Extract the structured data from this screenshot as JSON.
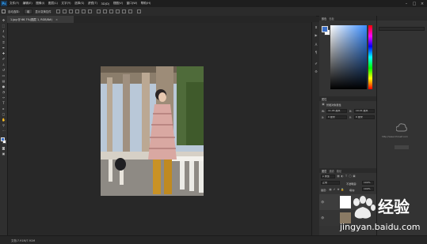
{
  "app": {
    "logo": "Ps"
  },
  "menubar": {
    "items": [
      "文件(F)",
      "编辑(E)",
      "图像(I)",
      "图层(L)",
      "文字(Y)",
      "选择(S)",
      "滤镜(T)",
      "3D(D)",
      "视图(V)",
      "窗口(W)",
      "帮助(H)"
    ],
    "window_controls": [
      "minimize-icon",
      "maximize-icon",
      "close-icon"
    ]
  },
  "optionsbar": {
    "labels": [
      "自动选择：",
      "组",
      "显示变换控件"
    ]
  },
  "document": {
    "tab_label": "1.jpg @ 66.7%(图层 1, RGB/8#)",
    "close_glyph": "×"
  },
  "statusbar": {
    "text": "文档:7.91M/7.91M"
  },
  "color_panel": {
    "title": "颜色",
    "tab2": "色板",
    "colors": {
      "foreground": "#3a6fc8",
      "background": "#ffffff",
      "field_top_right": "#3a8dff"
    }
  },
  "properties_panel": {
    "title": "属性",
    "subtitle": "智能对象属性",
    "w_label": "W:",
    "w_value": "11.45 厘米",
    "h_label": "H:",
    "h_value": "19.01 厘米",
    "x_label": "X:",
    "x_value": "0 厘米",
    "y_label": "Y:",
    "y_value": "0 厘米"
  },
  "layers_panel": {
    "title": "图层",
    "tab2": "通道",
    "tab3": "路径",
    "kind_label": "ρ 类型",
    "blend_mode": "正常",
    "opacity_label": "不透明度:",
    "opacity_value": "100%",
    "lock_label": "锁定:",
    "fill_label": "填充:",
    "fill_value": "100%",
    "layer_name": "图层 1"
  },
  "watermark": {
    "site": "jingyan.baidu.com",
    "brand": "经验",
    "small_text": "http://www.ChinaZ.com"
  }
}
